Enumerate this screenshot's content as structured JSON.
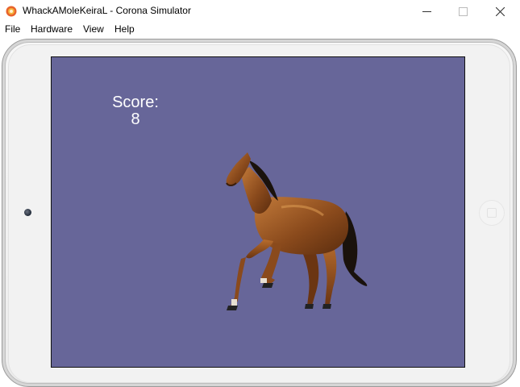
{
  "window": {
    "title": "WhackAMoleKeiraL - Corona Simulator",
    "app_icon": "corona-logo-icon",
    "controls": [
      "minimize-icon",
      "maximize-icon",
      "close-icon"
    ]
  },
  "menubar": {
    "items": [
      {
        "label": "File"
      },
      {
        "label": "Hardware"
      },
      {
        "label": "View"
      },
      {
        "label": "Help"
      }
    ]
  },
  "device": {
    "type": "tablet-landscape",
    "bezel_color": "#f2f2f2",
    "camera_icon": "camera-icon",
    "home_button_icon": "home-button-icon"
  },
  "game": {
    "background_color": "#676699",
    "score_label": "Score:",
    "score_value": "8",
    "sprite": "horse-image"
  }
}
